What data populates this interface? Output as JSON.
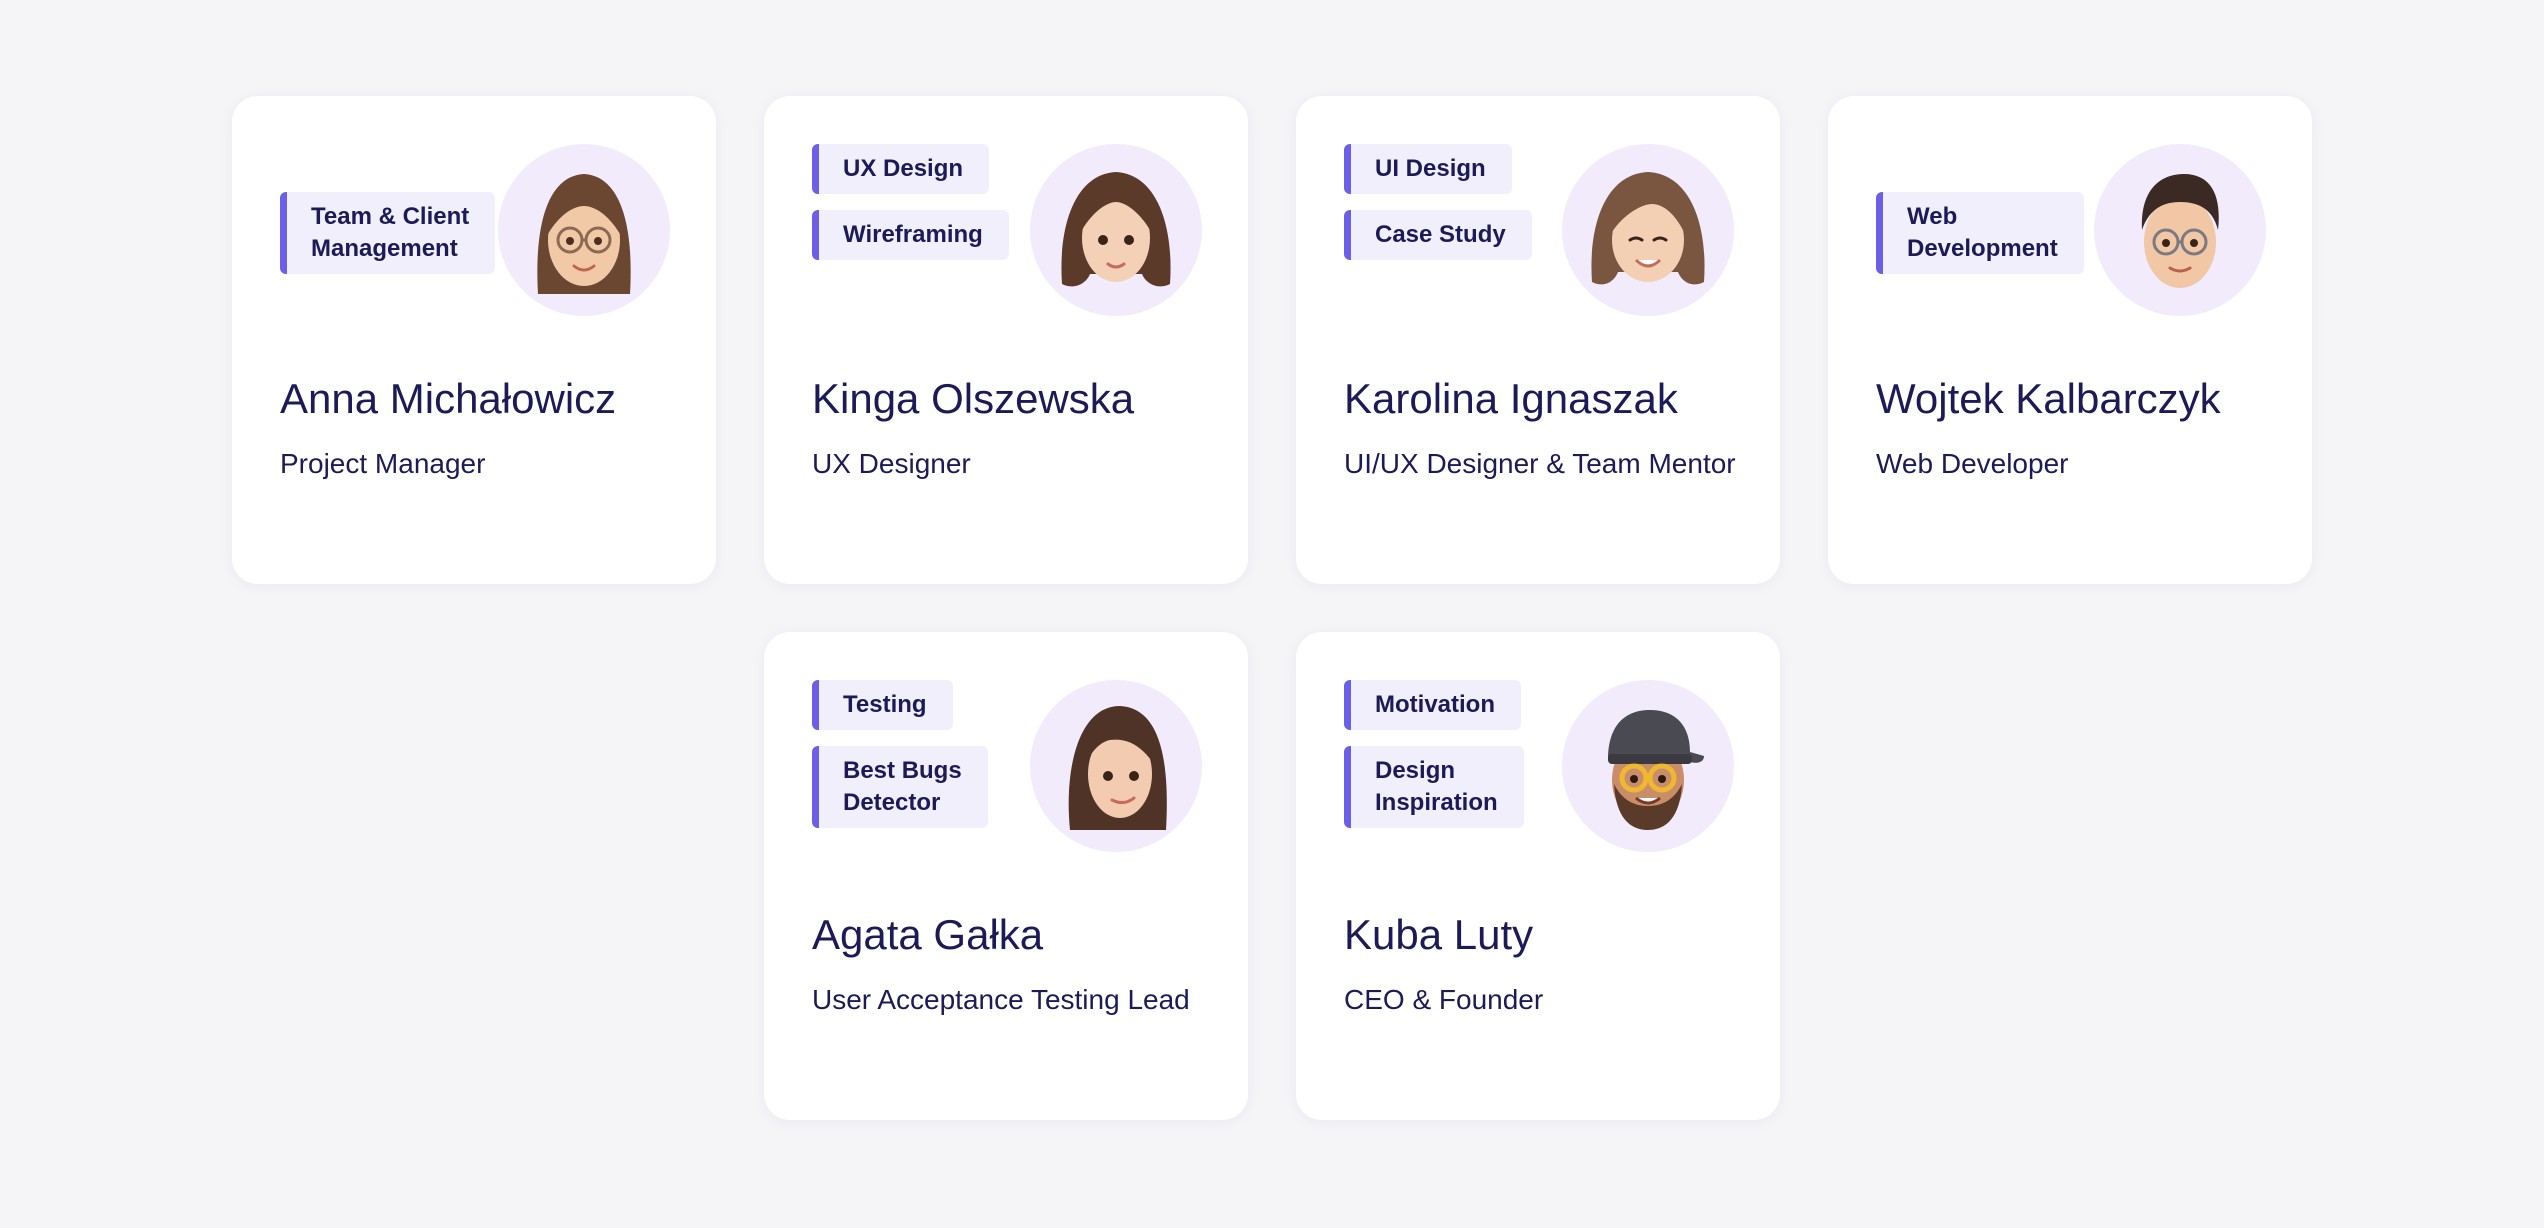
{
  "team": [
    {
      "name": "Anna Michałowicz",
      "role": "Project Manager",
      "tags": [
        "Team & Client\nManagement"
      ],
      "avatar": "memoji-woman-glasses-icon"
    },
    {
      "name": "Kinga Olszewska",
      "role": "UX Designer",
      "tags": [
        "UX Design",
        "Wireframing"
      ],
      "avatar": "memoji-woman-brown-hair-icon"
    },
    {
      "name": "Karolina Ignaszak",
      "role": "UI/UX Designer & Team Mentor",
      "tags": [
        "UI Design",
        "Case Study"
      ],
      "avatar": "memoji-woman-smiling-icon"
    },
    {
      "name": "Wojtek Kalbarczyk",
      "role": "Web Developer",
      "tags": [
        "Web\nDevelopment"
      ],
      "avatar": "memoji-man-glasses-icon"
    },
    {
      "name": "Agata Gałka",
      "role": "User Acceptance Testing Lead",
      "tags": [
        "Testing",
        "Best Bugs\nDetector"
      ],
      "avatar": "memoji-woman-long-hair-icon"
    },
    {
      "name": "Kuba Luty",
      "role": "CEO & Founder",
      "tags": [
        "Motivation",
        "Design\nInspiration"
      ],
      "avatar": "memoji-man-cap-beard-icon"
    }
  ],
  "colors": {
    "background": "#f5f5f8",
    "card": "#ffffff",
    "text": "#1c1a57",
    "tag_bg": "#f2effc",
    "tag_accent": "#6a5fe6",
    "avatar_bg": "#f1ebfc"
  }
}
